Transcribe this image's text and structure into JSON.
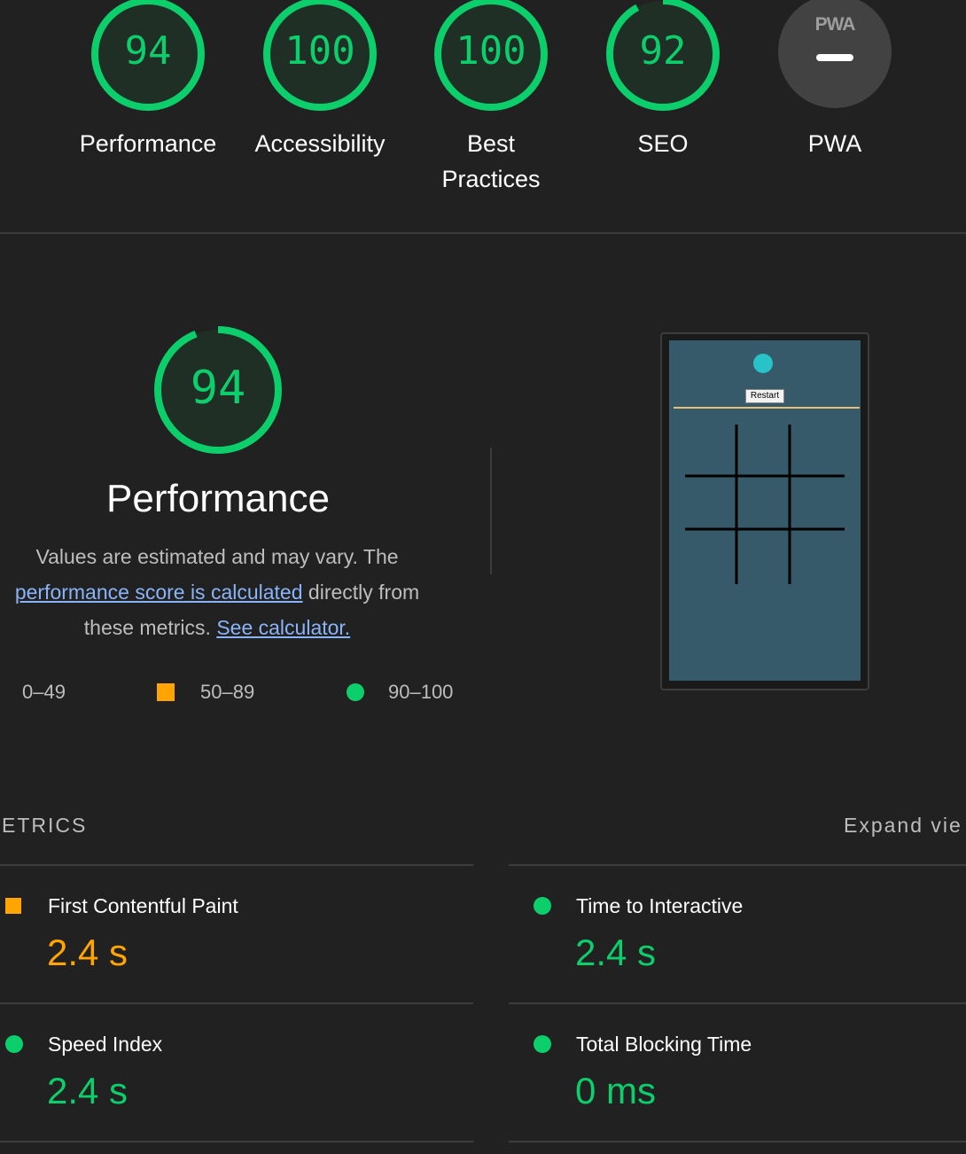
{
  "gauges": [
    {
      "label": "Performance",
      "score": "94"
    },
    {
      "label": "Accessibility",
      "score": "100"
    },
    {
      "label": "Best Practices",
      "score": "100"
    },
    {
      "label": "SEO",
      "score": "92"
    },
    {
      "label": "PWA",
      "badge": "PWA"
    }
  ],
  "performance": {
    "score": "94",
    "title": "Performance",
    "desc_1": "Values are estimated and may vary. The",
    "link_1": "performance score is calculated",
    "desc_2": " directly from",
    "desc_3": "these metrics. ",
    "link_2": "See calculator.",
    "legend": {
      "fail": "0–49",
      "average": "50–89",
      "pass": "90–100"
    }
  },
  "screenshot": {
    "button_label": "Restart"
  },
  "metrics": {
    "header": "ETRICS",
    "expand": "Expand vie",
    "items": [
      {
        "name": "First Contentful Paint",
        "value": "2.4 s",
        "status": "average"
      },
      {
        "name": "Time to Interactive",
        "value": "2.4 s",
        "status": "pass"
      },
      {
        "name": "Speed Index",
        "value": "2.4 s",
        "status": "pass"
      },
      {
        "name": "Total Blocking Time",
        "value": "0 ms",
        "status": "pass"
      }
    ]
  },
  "colors": {
    "pass": "#0cce6b",
    "average": "#ffa400",
    "background": "#212121",
    "link": "#8ab4f8"
  }
}
